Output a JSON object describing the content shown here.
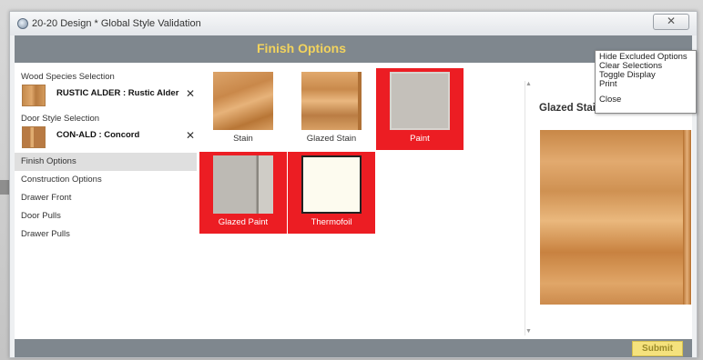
{
  "window": {
    "title": "20-20 Design * Global Style Validation",
    "close_glyph": "✕"
  },
  "header": {
    "title": "Finish Options"
  },
  "selections": [
    {
      "label": "Wood Species Selection",
      "value": "RUSTIC ALDER : Rustic Alder",
      "remove": "✕",
      "thumb_icon": "wood-swatch"
    },
    {
      "label": "Door Style Selection",
      "value": "CON-ALD : Concord",
      "remove": "✕",
      "thumb_icon": "door-swatch"
    }
  ],
  "nav": [
    {
      "label": "Finish Options",
      "active": true
    },
    {
      "label": "Construction Options",
      "active": false
    },
    {
      "label": "Drawer Front",
      "active": false
    },
    {
      "label": "Door Pulls",
      "active": false
    },
    {
      "label": "Drawer Pulls",
      "active": false
    }
  ],
  "options": [
    {
      "label": "Stain",
      "selected": false
    },
    {
      "label": "Glazed Stain",
      "selected": false
    },
    {
      "label": "Paint",
      "selected": true
    },
    {
      "label": "Glazed Paint",
      "selected": true
    },
    {
      "label": "Thermofoil",
      "selected": true
    }
  ],
  "preview": {
    "title": "Glazed Stain"
  },
  "menu": {
    "items": [
      "Hide Excluded Options",
      "Clear Selections",
      "Toggle Display",
      "Print",
      "Close"
    ]
  },
  "footer": {
    "submit_label": "Submit"
  },
  "colors": {
    "accent": "#f2d35d",
    "selected": "#ec1d23",
    "bar": "#7f878e",
    "submit": "#f5e27d"
  }
}
